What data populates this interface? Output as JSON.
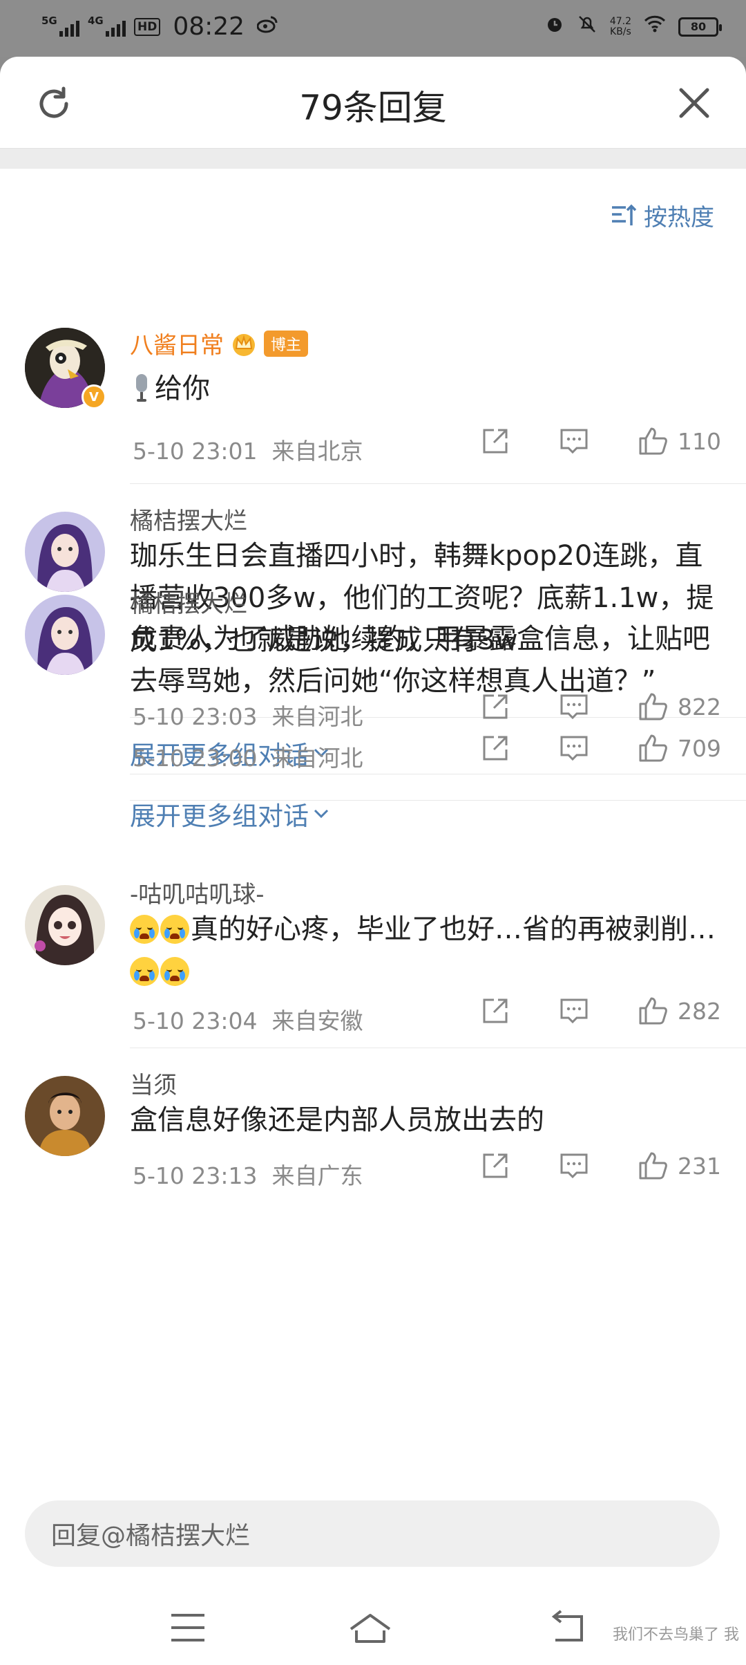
{
  "status_bar": {
    "sim1": "5G",
    "sim2": "4G",
    "hd": "HD",
    "time": "08:22",
    "speed_value": "47.2",
    "speed_unit": "KB/s",
    "battery": "80"
  },
  "sheet": {
    "title": "79条回复",
    "sort_label": "按热度"
  },
  "comments": [
    {
      "user": "八酱日常",
      "badge": "博主",
      "text": "给你",
      "time": "5-10 23:01",
      "location": "来自北京",
      "likes": "110"
    },
    {
      "user": "橘桔摆大烂",
      "text": "珈乐生日会直播四小时，韩舞kpop20连跳，直播营收300多w，他们的工资呢？底薪1.1w，提成1%，也就是说，提成只有3w",
      "time": "5-10 23:03",
      "location": "来自河北",
      "likes": "822",
      "expand": "展开更多组对话"
    },
    {
      "user": "橘桔摆大烂",
      "text": "负责人为了威胁她续约，用暴露盒信息，让贴吧去辱骂她，然后问她“你这样想真人出道？”",
      "time": "5-10 23:00",
      "location": "来自河北",
      "likes": "709",
      "expand": "展开更多组对话"
    },
    {
      "user": "-咕叽咕叽球-",
      "text_main": "真的好心疼，毕业了也好…省的再被剥削…",
      "time": "5-10 23:04",
      "location": "来自安徽",
      "likes": "282"
    },
    {
      "user": "当须",
      "text": "盒信息好像还是内部人员放出去的",
      "time": "5-10 23:13",
      "location": "来自广东",
      "likes": "231"
    }
  ],
  "reply_bar": {
    "placeholder": "回复@橘桔摆大烂"
  },
  "watermark": "我们不去鸟巢了 我",
  "colors": {
    "link_blue": "#4f7fb3",
    "blogger_orange": "#f07f1e",
    "meta_gray": "#8a8a8a"
  },
  "icons": [
    "refresh-icon",
    "close-icon",
    "sort-icon",
    "share-icon",
    "comment-icon",
    "like-icon",
    "menu-icon",
    "home-icon",
    "back-icon"
  ]
}
